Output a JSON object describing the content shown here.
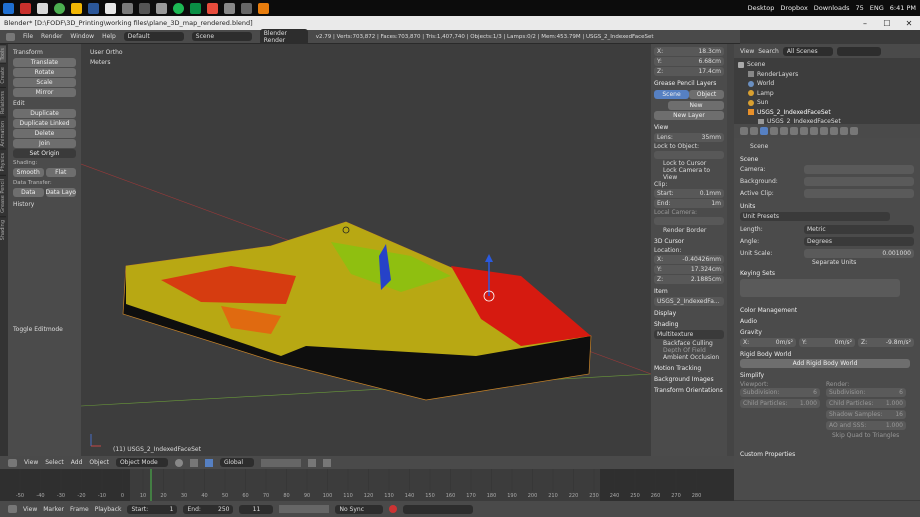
{
  "taskbar": {
    "items": [
      "Desktop",
      "Dropbox",
      "Downloads"
    ],
    "battery": "75",
    "lang": "ENG",
    "time": "6:41 PM"
  },
  "window": {
    "title": "Blender* [D:\\FODF\\3D_Printing\\working files\\plane_3D_map_rendered.blend]"
  },
  "menubar": {
    "items": [
      "File",
      "Render",
      "Window",
      "Help"
    ],
    "layout": "Default",
    "scene": "Scene",
    "engine": "Blender Render",
    "stats": "v2.79 | Verts:703,872 | Faces:703,870 | Tris:1,407,740 | Objects:1/3 | Lamps:0/2 | Mem:453.79M | USGS_2_IndexedFaceSet"
  },
  "lefttabs": [
    "Tools",
    "Create",
    "Relations",
    "Animation",
    "Physics",
    "Grease Pencil",
    "Shading"
  ],
  "toolshelf": {
    "transform_header": "Transform",
    "transform": [
      "Translate",
      "Rotate",
      "Scale",
      "Mirror"
    ],
    "edit_header": "Edit",
    "edit": [
      "Duplicate",
      "Duplicate Linked",
      "Delete",
      "Join"
    ],
    "set_origin": "Set Origin",
    "shading_label": "Shading:",
    "shading": [
      "Smooth",
      "Flat"
    ],
    "data_transfer_label": "Data Transfer:",
    "data_transfer": [
      "Data",
      "Data Layo"
    ],
    "history": "History",
    "toggle_editmode": "Toggle Editmode"
  },
  "viewport": {
    "view_name": "User Ortho",
    "units": "Meters",
    "object_label": "(11) USGS_2_IndexedFaceSet"
  },
  "npanel": {
    "x": "18.3cm",
    "y": "6.68cm",
    "z": "17.4cm",
    "gp_layers": "Grease Pencil Layers",
    "scene_tab": "Scene",
    "object_tab": "Object",
    "new": "New",
    "new_layer": "New Layer",
    "view": "View",
    "lens_label": "Lens:",
    "lens": "35mm",
    "lock_object": "Lock to Object:",
    "lock_cursor": "Lock to Cursor",
    "lock_camera": "Lock Camera to View",
    "clip": "Clip:",
    "start_label": "Start:",
    "start": "0.1mm",
    "end_label": "End:",
    "end": "1m",
    "local_camera": "Local Camera:",
    "render_border": "Render Border",
    "cursor_header": "3D Cursor",
    "location": "Location:",
    "cx": "-0.40426mm",
    "cy": "17.324cm",
    "cz": "2.1885cm",
    "item": "Item",
    "item_name": "USGS_2_IndexedFa...",
    "display": "Display",
    "shading": "Shading",
    "multitexture": "Multitexture",
    "backface": "Backface Culling",
    "depth": "Depth Of Field",
    "ao": "Ambient Occlusion",
    "motion": "Motion Tracking",
    "bg_images": "Background Images",
    "orientations": "Transform Orientations"
  },
  "outliner": {
    "view": "View",
    "search": "Search",
    "scenes": "All Scenes",
    "rows": [
      "Scene",
      "RenderLayers",
      "World",
      "Lamp",
      "Sun",
      "USGS_2_IndexedFaceSet",
      "USGS_2_IndexedFaceSet"
    ]
  },
  "props": {
    "scene_path": "Scene",
    "scene_header": "Scene",
    "camera_label": "Camera:",
    "background_label": "Background:",
    "active_clip_label": "Active Clip:",
    "units_header": "Units",
    "unit_presets": "Unit Presets",
    "length_label": "Length:",
    "length": "Metric",
    "angle_label": "Angle:",
    "angle": "Degrees",
    "unit_scale_label": "Unit Scale:",
    "unit_scale": "0.001000",
    "separate_units": "Separate Units",
    "keying_sets": "Keying Sets",
    "color_mgmt": "Color Management",
    "audio": "Audio",
    "gravity": "Gravity",
    "gx": "X:",
    "gx_val": "0m/s²",
    "gy": "Y:",
    "gy_val": "0m/s²",
    "gz": "Z:",
    "gz_val": "-9.8m/s²",
    "rigid_body": "Rigid Body World",
    "add_rigid": "Add Rigid Body World",
    "simplify": "Simplify",
    "viewport": "Viewport:",
    "render": "Render:",
    "subdivision": "Subdivision:",
    "sub_v": "6",
    "sub_r": "6",
    "child_particles": "Child Particles:",
    "cp_v": "1.000",
    "cp_r": "1.000",
    "shadow_samples": "Shadow Samples:",
    "ss_r": "16",
    "ao_sss": "AO and SSS:",
    "ao_r": "1.000",
    "skip_quad": "Skip Quad to Triangles",
    "custom_props": "Custom Properties"
  },
  "vpheader": {
    "items": [
      "View",
      "Select",
      "Add",
      "Object"
    ],
    "mode": "Object Mode",
    "orientation": "Global"
  },
  "timeline": {
    "ticks": [
      "-50",
      "-40",
      "-30",
      "-20",
      "-10",
      "0",
      "10",
      "20",
      "30",
      "40",
      "50",
      "60",
      "70",
      "80",
      "90",
      "100",
      "110",
      "120",
      "130",
      "140",
      "150",
      "160",
      "170",
      "180",
      "190",
      "200",
      "210",
      "220",
      "230",
      "240",
      "250",
      "260",
      "270",
      "280"
    ],
    "menus": [
      "View",
      "Marker",
      "Frame",
      "Playback"
    ],
    "start_label": "Start:",
    "start": "1",
    "end_label": "End:",
    "end": "250",
    "current": "11",
    "sync": "No Sync"
  }
}
